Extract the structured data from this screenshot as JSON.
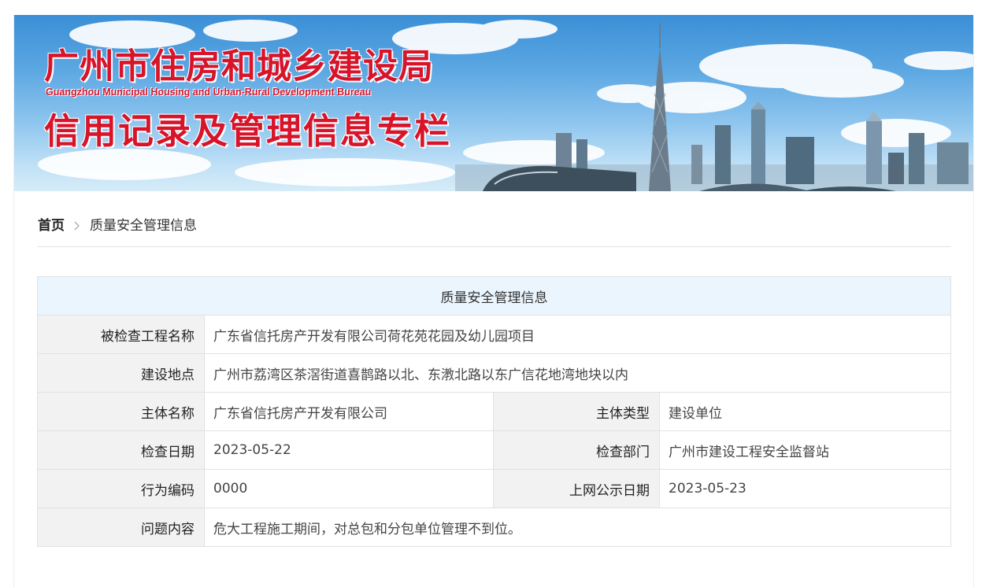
{
  "banner": {
    "title_cn": "广州市住房和城乡建设局",
    "title_en": "Guangzhou Municipal Housing and Urban-Rural Development Bureau",
    "subtitle": "信用记录及管理信息专栏"
  },
  "breadcrumb": {
    "home": "首页",
    "current": "质量安全管理信息"
  },
  "table": {
    "caption": "质量安全管理信息",
    "project_name": {
      "label": "被检查工程名称",
      "value": "广东省信托房产开发有限公司荷花苑花园及幼儿园项目"
    },
    "location": {
      "label": "建设地点",
      "value": "广州市荔湾区茶滘街道喜鹊路以北、东漖北路以东广信花地湾地块以内"
    },
    "entity_name": {
      "label": "主体名称",
      "value": "广东省信托房产开发有限公司"
    },
    "entity_type": {
      "label": "主体类型",
      "value": "建设单位"
    },
    "inspect_date": {
      "label": "检查日期",
      "value": "2023-05-22"
    },
    "inspect_dept": {
      "label": "检查部门",
      "value": "广州市建设工程安全监督站"
    },
    "behavior_code": {
      "label": "行为编码",
      "value": "0000"
    },
    "publish_date": {
      "label": "上网公示日期",
      "value": "2023-05-23"
    },
    "problem": {
      "label": "问题内容",
      "value": "危大工程施工期间，对总包和分包单位管理不到位。"
    }
  },
  "colors": {
    "title_red": "#d7142a",
    "caption_bg": "#eaf5fd",
    "label_bg": "#f2f2f2",
    "border": "#e2e2e2"
  }
}
